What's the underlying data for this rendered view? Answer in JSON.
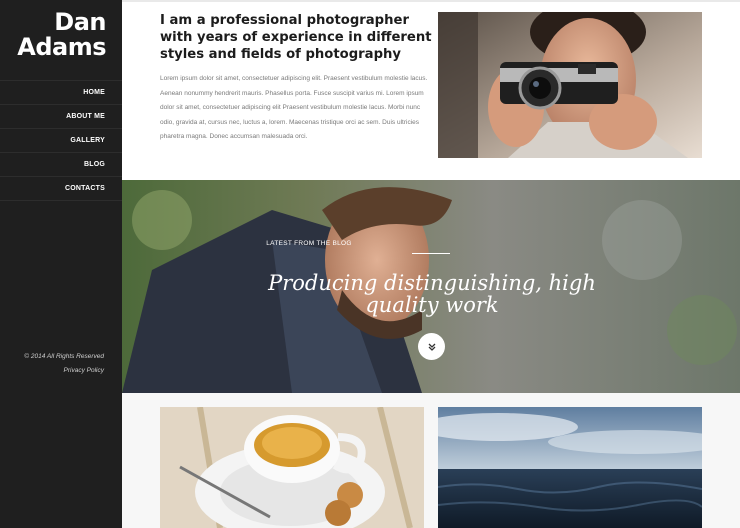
{
  "brand": {
    "line1": "Dan",
    "line2": "Adams"
  },
  "nav": {
    "items": [
      {
        "label": "HOME"
      },
      {
        "label": "ABOUT ME"
      },
      {
        "label": "GALLERY"
      },
      {
        "label": "BLOG"
      },
      {
        "label": "CONTACTS"
      }
    ]
  },
  "footer": {
    "copyright": "© 2014 All Rights Reserved",
    "privacy": "Privacy Policy"
  },
  "intro": {
    "heading": "I am a professional photographer with years of experience in different styles and fields of photography",
    "body": "Lorem ipsum dolor sit amet, consectetuer adipiscing elit. Praesent vestibulum molestie lacus. Aenean nonummy hendrerit mauris. Phasellus porta. Fusce suscipit varius mi. Lorem ipsum dolor sit amet, consectetuer adipiscing elit Praesent vestibulum molestie lacus. Morbi nunc odio, gravida at, cursus nec, luctus a, lorem. Maecenas tristique orci ac sem. Duis ultricies pharetra magna. Donec accumsan malesuada orci."
  },
  "hero": {
    "label": "LATEST FROM THE BLOG",
    "title": "Producing distinguishing, high quality work",
    "scroll_icon": "chevron-double-down-icon"
  },
  "colors": {
    "sidebar": "#1f1f1f",
    "text_dark": "#1c1c1c",
    "text_muted": "#7a7a7a"
  }
}
